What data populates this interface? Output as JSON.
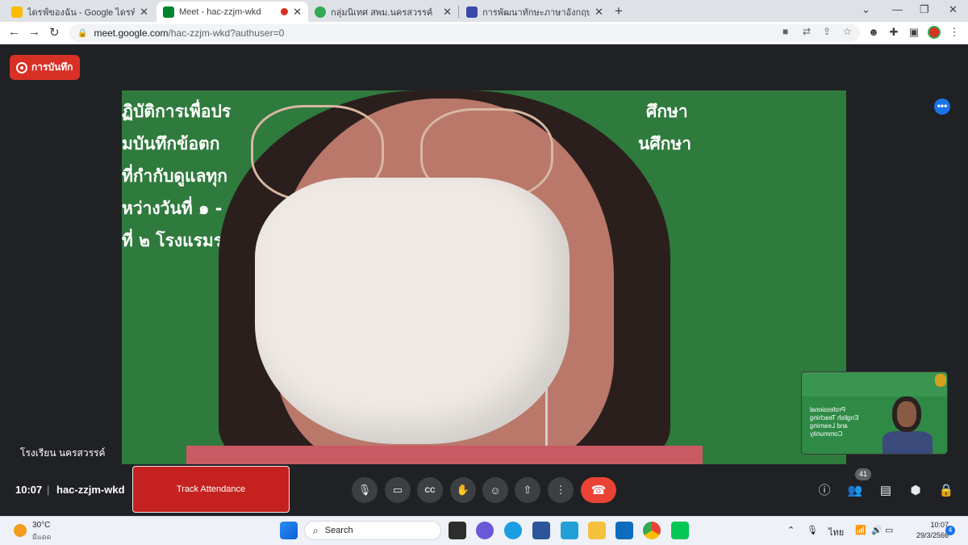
{
  "browser": {
    "tabs": [
      {
        "title": "ไดรฟ์ของฉัน - Google ไดรฟ์",
        "color": "#1e8e3e"
      },
      {
        "title": "Meet - hac-zzjm-wkd",
        "color": "#00832d"
      },
      {
        "title": "กลุ่มนิเทศ สพม.นครสวรรค์",
        "color": "#34a853"
      },
      {
        "title": "การพัฒนาทักษะภาษาอังกฤษ English",
        "color": "#3949ab"
      }
    ],
    "tab_close": "✕",
    "new_tab": "+",
    "url_host": "meet.google.com",
    "url_path": "/hac-zzjm-wkd?authuser=0"
  },
  "meet": {
    "record_label": "การบันทึก",
    "slide_lines": [
      "ฏิบัติการเพื่อปร",
      "มบันทึกข้อตก",
      "ที่กำกับดูแลทุก",
      "หว่างวันที่ ๑ - ",
      "ที่ ๒ โรงแรมรอ"
    ],
    "slide_lines_right": [
      "ศึกษา",
      "นศึกษา"
    ],
    "speaker_name": "โรงเรียน นครสวรรค์",
    "pip_text": "Professional English Teaching and Learning Community",
    "clock": "10:07",
    "clock_sep": "|",
    "meeting_code": "hac-zzjm-wkd",
    "track_label": "Track Attendance",
    "participant_count": "41"
  },
  "taskbar": {
    "temperature": "30°C",
    "condition": "มีแดด",
    "search_label": "Search",
    "language": "ไทย",
    "time": "10:07",
    "date": "29/3/2566",
    "notification_count": "4",
    "mail_badge": "1"
  }
}
